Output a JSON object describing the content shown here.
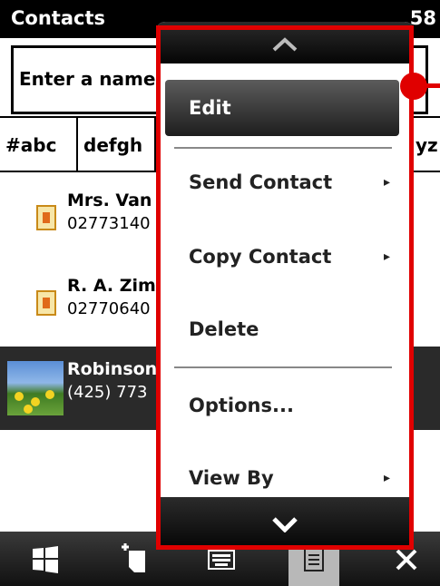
{
  "titlebar": {
    "title": "Contacts",
    "time": "58"
  },
  "search": {
    "placeholder": "Enter a name"
  },
  "tabs": [
    "#abc",
    "defgh",
    "yz"
  ],
  "contacts": [
    {
      "name": "Mrs. Van",
      "phone": "02773140"
    },
    {
      "name": "R. A. Zim",
      "phone": "02770640"
    },
    {
      "name": "Robinson",
      "phone": "(425) 773"
    }
  ],
  "menu": {
    "items": [
      {
        "label": "Edit",
        "arrow": ""
      },
      {
        "label": "Send Contact",
        "arrow": "▸"
      },
      {
        "label": "Copy Contact",
        "arrow": "▸"
      },
      {
        "label": "Delete",
        "arrow": ""
      },
      {
        "label": "Options...",
        "arrow": ""
      },
      {
        "label": "View By",
        "arrow": "▸"
      }
    ]
  },
  "icons": {
    "start": "windows-start-icon",
    "new": "new-contact-icon",
    "keyboard": "keyboard-icon",
    "menu": "menu-icon",
    "close": "close-icon"
  },
  "colors": {
    "annotation": "#e00000",
    "selected_row": "#2a2a2a"
  }
}
